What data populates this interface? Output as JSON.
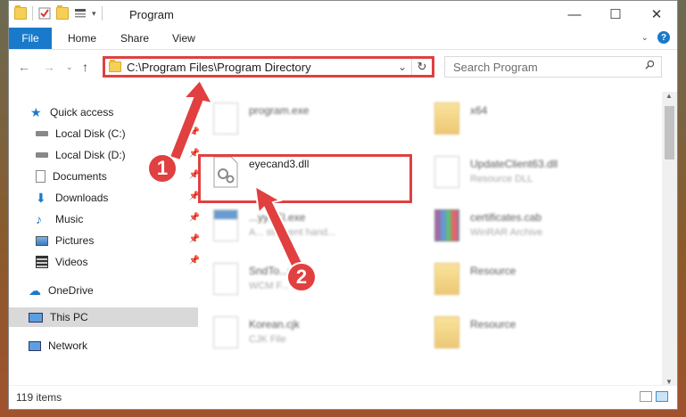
{
  "window": {
    "title": "Program"
  },
  "ribbon": {
    "tabs": [
      "File",
      "Home",
      "Share",
      "View"
    ]
  },
  "address": {
    "path": "C:\\Program Files\\Program Directory"
  },
  "search": {
    "placeholder": "Search Program"
  },
  "sidebar": {
    "items": [
      {
        "label": "Quick access",
        "icon": "star-icon",
        "pinned": false
      },
      {
        "label": "Local Disk (C:)",
        "icon": "drive-icon",
        "pinned": true
      },
      {
        "label": "Local Disk (D:)",
        "icon": "drive-icon",
        "pinned": true
      },
      {
        "label": "Documents",
        "icon": "documents-icon",
        "pinned": true
      },
      {
        "label": "Downloads",
        "icon": "downloads-icon",
        "pinned": true
      },
      {
        "label": "Music",
        "icon": "music-icon",
        "pinned": true
      },
      {
        "label": "Pictures",
        "icon": "pictures-icon",
        "pinned": true
      },
      {
        "label": "Videos",
        "icon": "videos-icon",
        "pinned": true
      },
      {
        "label": "OneDrive",
        "icon": "cloud-icon",
        "pinned": false
      },
      {
        "label": "This PC",
        "icon": "computer-icon",
        "pinned": false,
        "selected": true
      },
      {
        "label": "Network",
        "icon": "network-icon",
        "pinned": false
      }
    ]
  },
  "files": [
    {
      "name": "program.exe",
      "type": "",
      "icon": "exe-icon"
    },
    {
      "name": "x64",
      "type": "",
      "icon": "folder-icon"
    },
    {
      "name": "eyecand3.dll",
      "type": "",
      "icon": "dll-icon",
      "highlighted": true
    },
    {
      "name": "UpdateClient63.dll",
      "type": "Resource DLL",
      "icon": "dll-icon"
    },
    {
      "name": "...yySTI.exe",
      "type": "A... sti event hand...",
      "icon": "exe-icon"
    },
    {
      "name": "certificates.cab",
      "type": "WinRAR Archive",
      "icon": "archive-icon"
    },
    {
      "name": "SndTo...wcm",
      "type": "WCM F...",
      "icon": "file-icon"
    },
    {
      "name": "Resource",
      "type": "",
      "icon": "folder-icon"
    },
    {
      "name": "Korean.cjk",
      "type": "CJK File",
      "icon": "file-icon"
    },
    {
      "name": "Resource",
      "type": "",
      "icon": "folder-icon"
    }
  ],
  "status": {
    "item_count": "119 items"
  },
  "annotations": {
    "step1": "1",
    "step2": "2"
  },
  "colors": {
    "accent": "#1979ca",
    "highlight": "#e04040"
  }
}
